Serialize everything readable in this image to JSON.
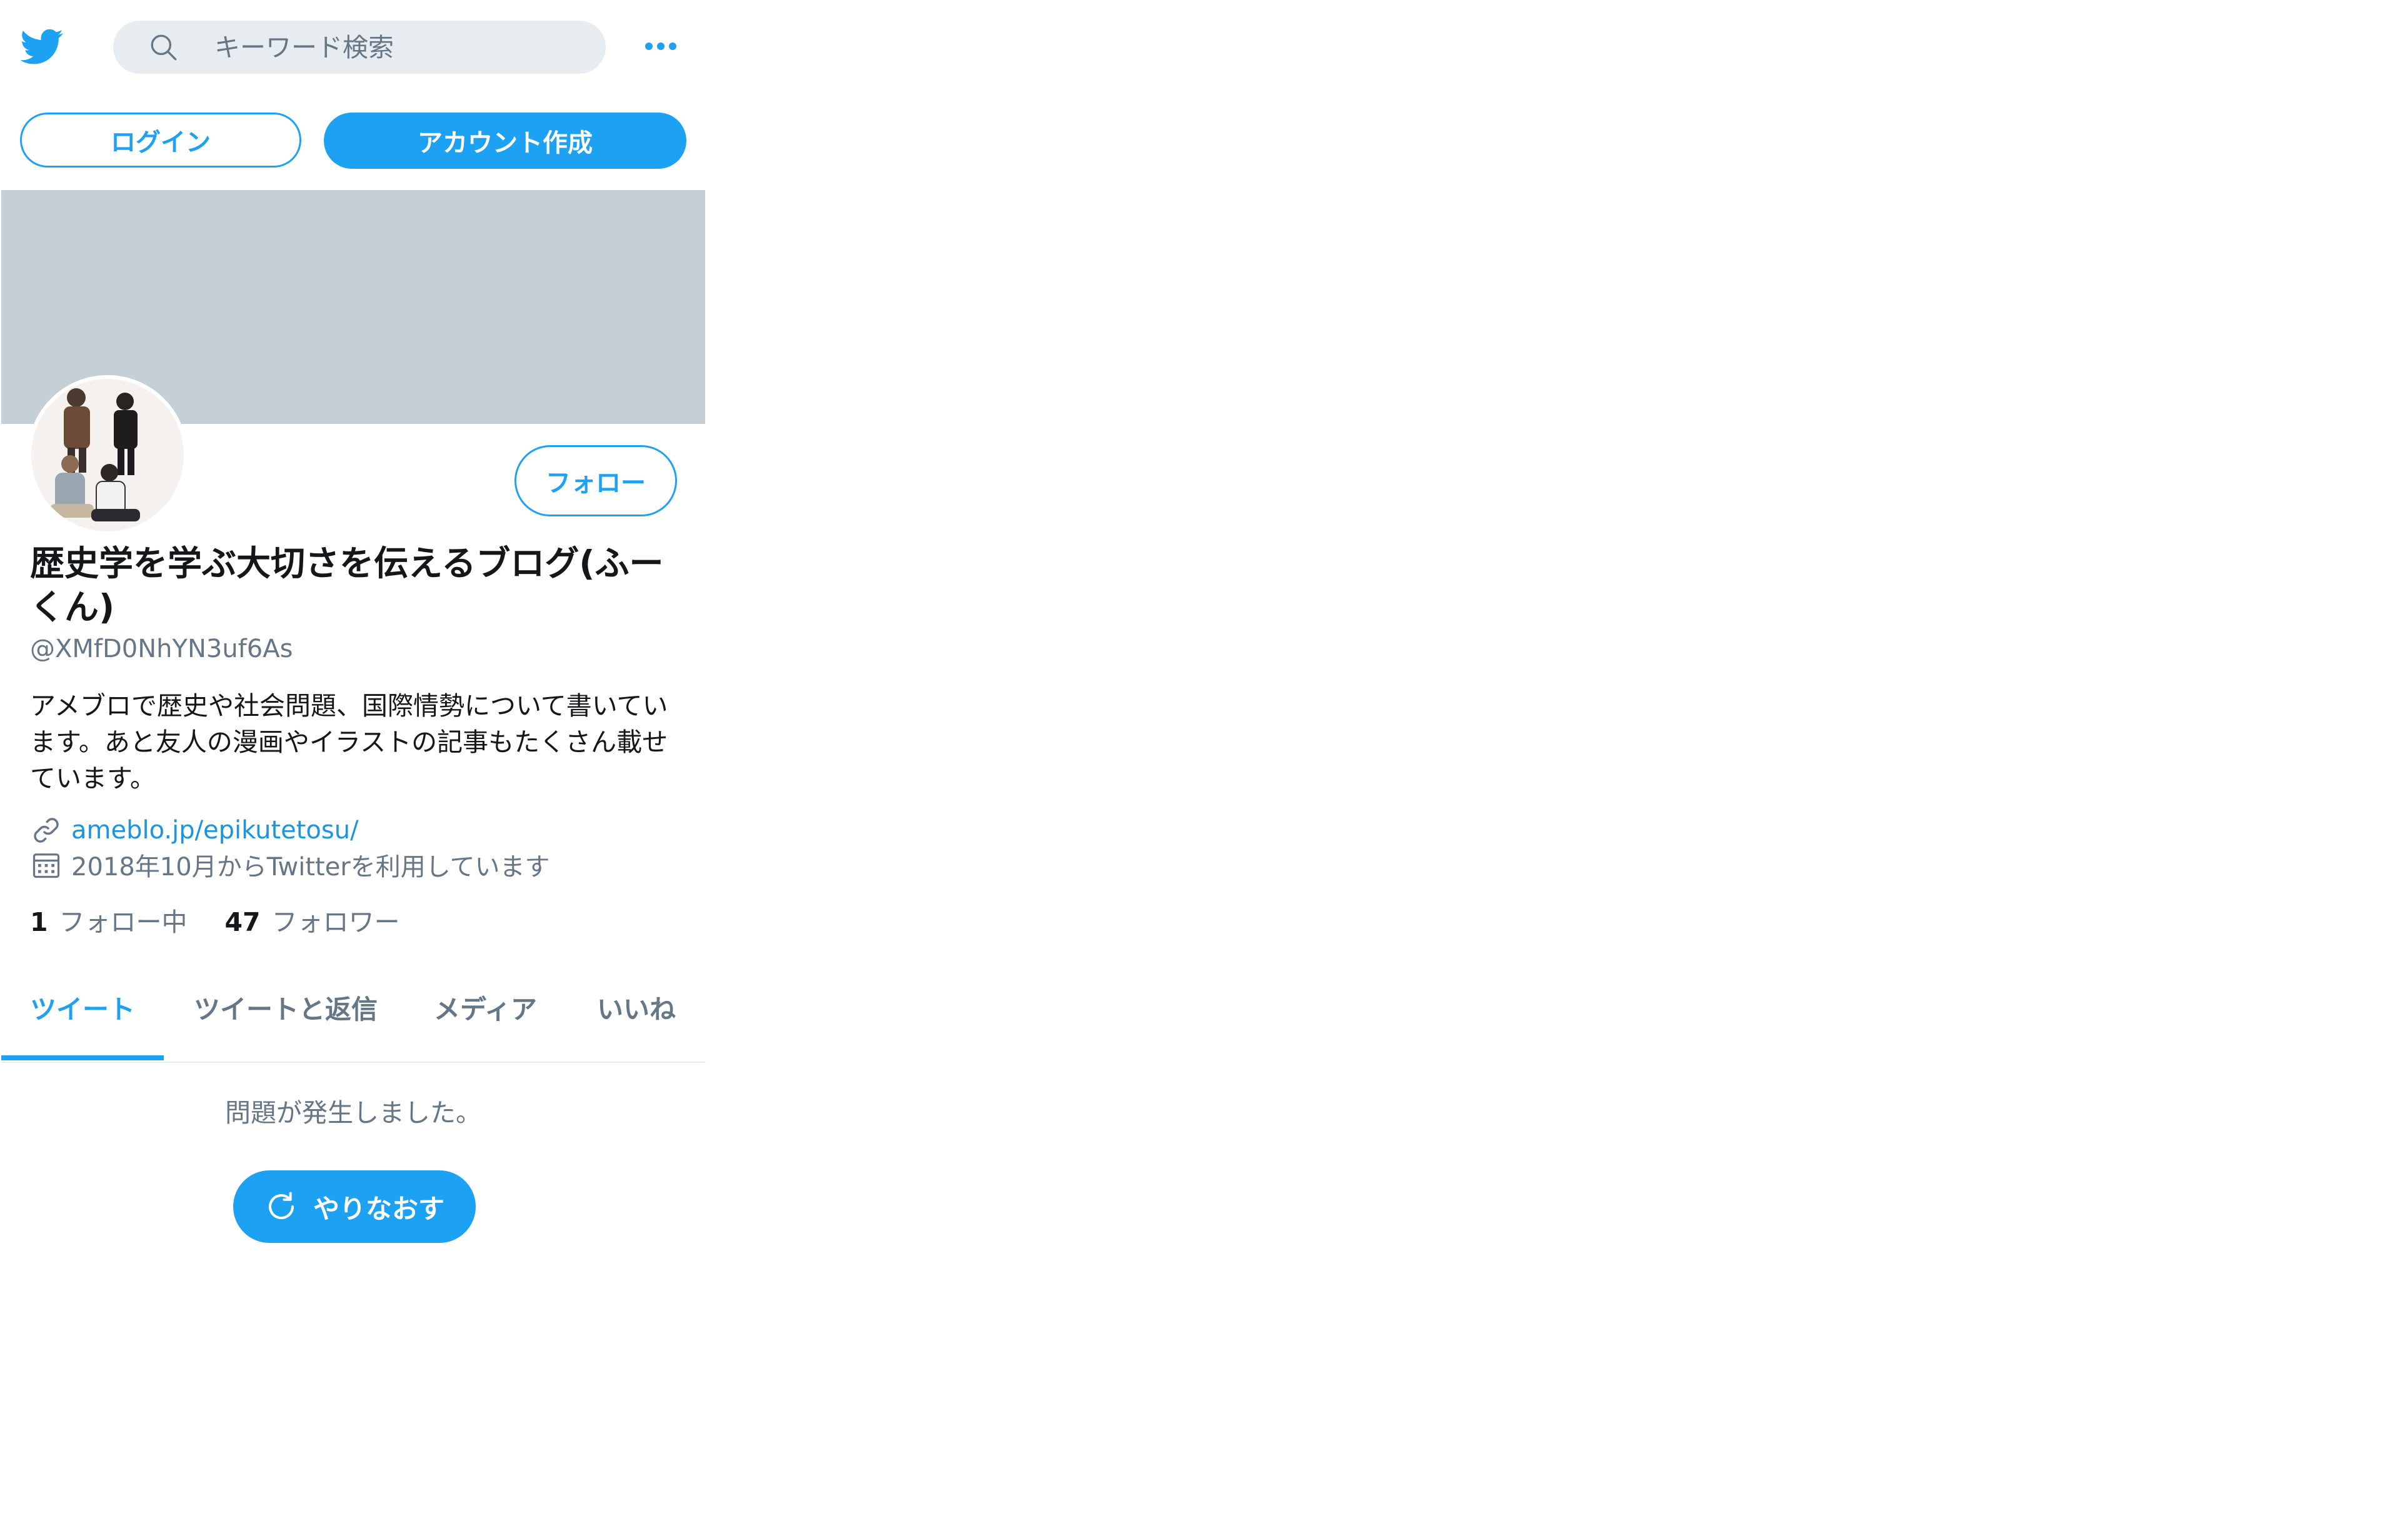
{
  "header": {
    "logo_icon": "twitter-bird-icon",
    "search": {
      "placeholder": "キーワード検索",
      "value": ""
    },
    "more_icon": "more-dots-icon"
  },
  "auth": {
    "login_label": "ログイン",
    "signup_label": "アカウント作成"
  },
  "profile": {
    "follow_label": "フォロー",
    "display_name": "歴史学を学ぶ大切さを伝えるブログ(ふーくん)",
    "handle": "@XMfD0NhYN3uf6As",
    "bio": "アメブロで歴史や社会問題、国際情勢について書いています。あと友人の漫画やイラストの記事もたくさん載せています。",
    "url": "ameblo.jp/epikutetosu/",
    "joined": "2018年10月からTwitterを利用しています",
    "following_count": "1",
    "following_label": "フォロー中",
    "followers_count": "47",
    "followers_label": "フォロワー"
  },
  "tabs": [
    {
      "label": "ツイート",
      "active": true
    },
    {
      "label": "ツイートと返信",
      "active": false
    },
    {
      "label": "メディア",
      "active": false
    },
    {
      "label": "いいね",
      "active": false
    }
  ],
  "timeline": {
    "error_message": "問題が発生しました。",
    "retry_label": "やりなおす"
  },
  "colors": {
    "accent": "#1da1f2",
    "banner": "#c4cfd6",
    "secondary_text": "#657786",
    "search_bg": "#e6ecf0"
  }
}
